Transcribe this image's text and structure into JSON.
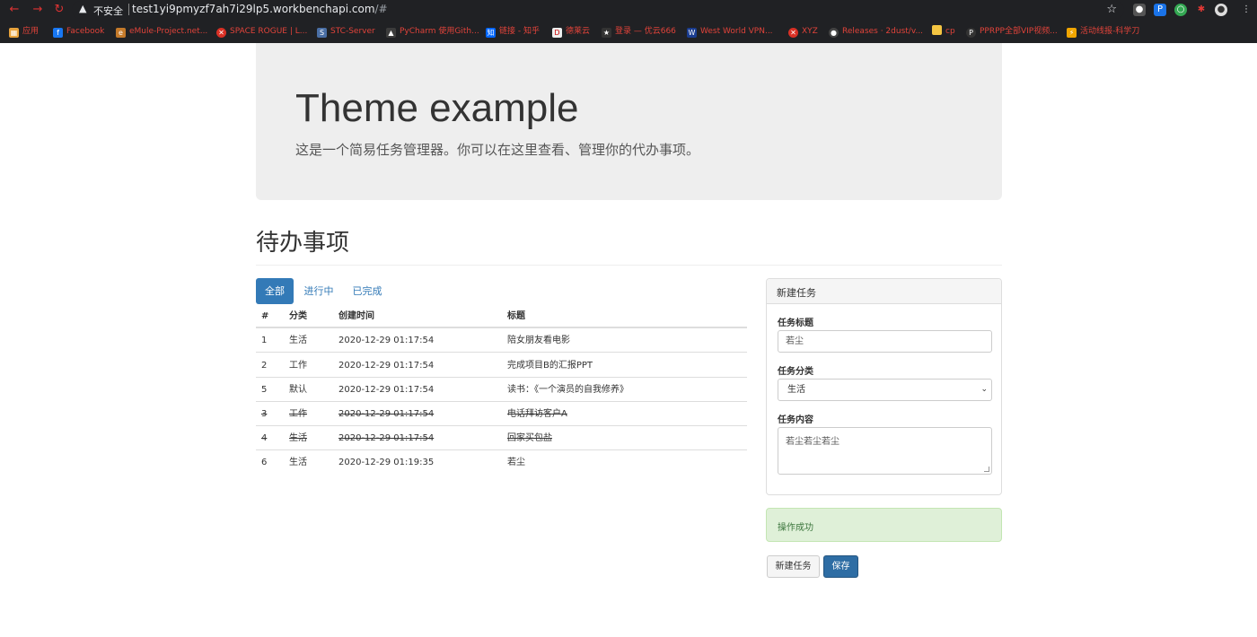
{
  "browser": {
    "insecure_label": "不安全",
    "url_host": "test1yi9pmyzf7ah7i29lp5.workbenchapi.com",
    "url_path": "/#",
    "bookmarks": [
      {
        "label": "应用"
      },
      {
        "label": "Facebook"
      },
      {
        "label": "eMule-Project.net..."
      },
      {
        "label": "SPACE ROGUE | L..."
      },
      {
        "label": "STC-Server"
      },
      {
        "label": "PyCharm 使用Gith..."
      },
      {
        "label": "链接 - 知乎"
      },
      {
        "label": "德莱云"
      },
      {
        "label": "登录 — 优云666"
      },
      {
        "label": "West World VPN..."
      },
      {
        "label": "XYZ"
      },
      {
        "label": "Releases · 2dust/v..."
      },
      {
        "label": "cp"
      },
      {
        "label": "PPRPP全部VIP视频..."
      },
      {
        "label": "活动线报-科学刀"
      }
    ]
  },
  "jumbotron": {
    "title": "Theme example",
    "subtitle": "这是一个简易任务管理器。你可以在这里查看、管理你的代办事项。"
  },
  "section_title": "待办事项",
  "tabs": [
    {
      "label": "全部",
      "active": true
    },
    {
      "label": "进行中",
      "active": false
    },
    {
      "label": "已完成",
      "active": false
    }
  ],
  "table": {
    "headers": [
      "#",
      "分类",
      "创建时间",
      "标题"
    ],
    "rows": [
      {
        "id": "1",
        "category": "生活",
        "created": "2020-12-29 01:17:54",
        "title": "陪女朋友看电影",
        "done": false
      },
      {
        "id": "2",
        "category": "工作",
        "created": "2020-12-29 01:17:54",
        "title": "完成项目B的汇报PPT",
        "done": false
      },
      {
        "id": "5",
        "category": "默认",
        "created": "2020-12-29 01:17:54",
        "title": "读书：《一个演员的自我修养》",
        "done": false
      },
      {
        "id": "3",
        "category": "工作",
        "created": "2020-12-29 01:17:54",
        "title": "电话拜访客户A",
        "done": true
      },
      {
        "id": "4",
        "category": "生活",
        "created": "2020-12-29 01:17:54",
        "title": "回家买包盐",
        "done": true
      },
      {
        "id": "6",
        "category": "生活",
        "created": "2020-12-29 01:19:35",
        "title": "若尘",
        "done": false
      }
    ]
  },
  "form": {
    "panel_title": "新建任务",
    "title_label": "任务标题",
    "title_value": "若尘",
    "category_label": "任务分类",
    "category_value": "生活",
    "content_label": "任务内容",
    "content_value": "若尘若尘若尘"
  },
  "alert": {
    "message": "操作成功"
  },
  "buttons": {
    "new_task": "新建任务",
    "save": "保存"
  },
  "colors": {
    "primary": "#337ab7",
    "success_bg": "#dff0d8",
    "jumbotron_bg": "#eeeeee"
  }
}
